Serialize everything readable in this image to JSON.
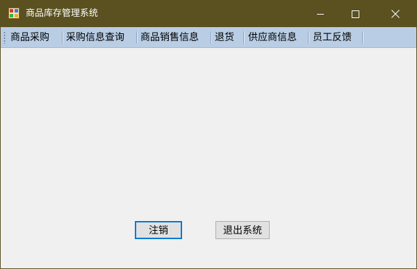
{
  "window": {
    "title": "商品库存管理系统",
    "colors": {
      "titlebar": "#5a5020",
      "menubar": "#b9cde5",
      "client": "#f0f0f0",
      "focus_border": "#0078d7"
    },
    "controls": {
      "minimize_icon": "minimize-icon",
      "maximize_icon": "maximize-icon",
      "close_icon": "close-icon"
    }
  },
  "menu": {
    "items": [
      {
        "label": "商品采购"
      },
      {
        "label": "采购信息查询"
      },
      {
        "label": "商品销售信息"
      },
      {
        "label": "退货"
      },
      {
        "label": "供应商信息"
      },
      {
        "label": "员工反馈"
      }
    ]
  },
  "buttons": {
    "logout_label": "注销",
    "exit_label": "退出系统"
  }
}
